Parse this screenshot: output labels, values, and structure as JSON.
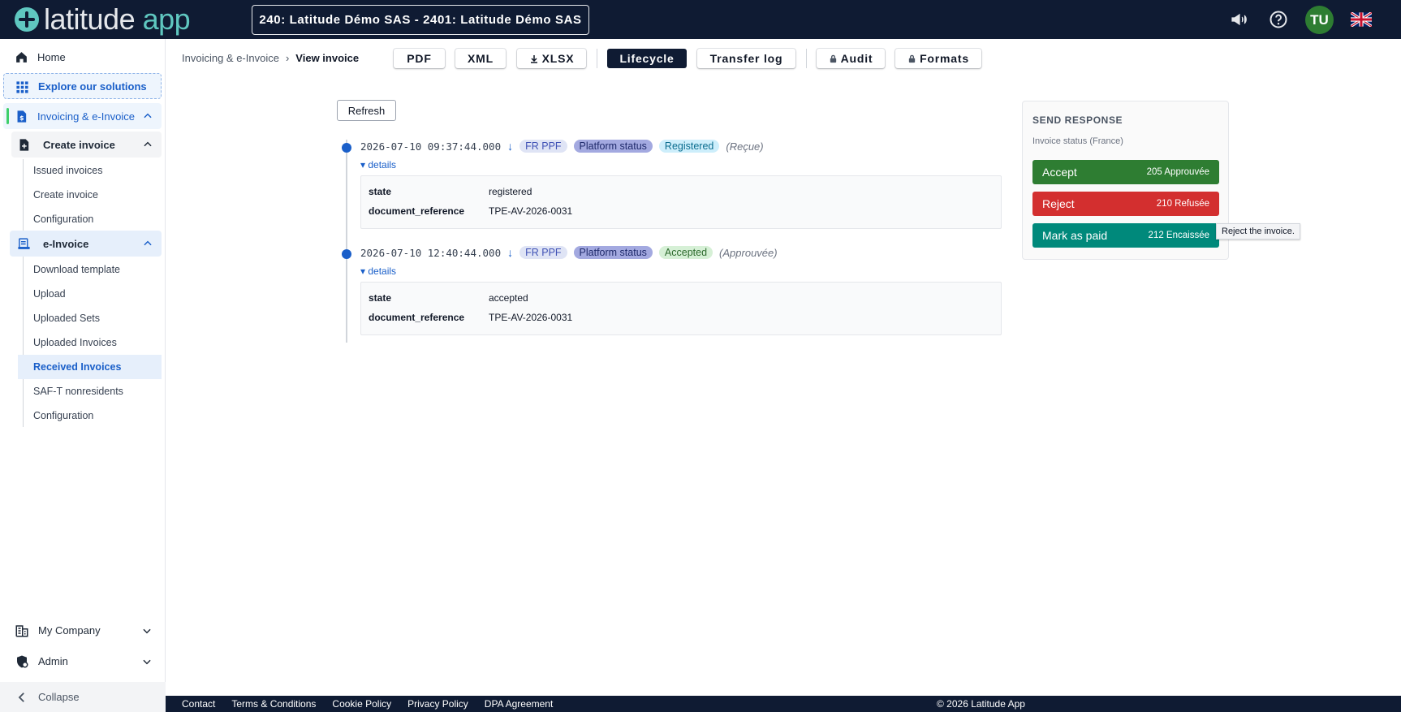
{
  "app": {
    "logo_word1": "latitude",
    "logo_word2": "app",
    "company": "240: Latitude Démo SAS - 2401: Latitude Démo SAS",
    "avatar": "TU"
  },
  "sidebar": {
    "home": "Home",
    "explore": "Explore our solutions",
    "invoicing": "Invoicing & e-Invoice",
    "create_group": "Create invoice",
    "create_items": [
      "Issued invoices",
      "Create invoice",
      "Configuration"
    ],
    "einvoice_group": "e-Invoice",
    "einvoice_items": [
      "Download template",
      "Upload",
      "Uploaded Sets",
      "Uploaded Invoices",
      "Received Invoices",
      "SAF-T nonresidents",
      "Configuration"
    ],
    "my_company": "My Company",
    "admin": "Admin",
    "collapse": "Collapse"
  },
  "breadcrumb": {
    "parent": "Invoicing & e-Invoice",
    "current": "View invoice"
  },
  "toolbar": {
    "pdf": "PDF",
    "xml": "XML",
    "xlsx": "XLSX",
    "lifecycle": "Lifecycle",
    "transfer_log": "Transfer log",
    "audit": "Audit",
    "formats": "Formats"
  },
  "refresh": "Refresh",
  "events": [
    {
      "timestamp": "2026-07-10 09:37:44.000",
      "arrow": "↓",
      "source": "FR PPF",
      "type": "Platform status",
      "status": "Registered",
      "note": "(Reçue)",
      "details": "details",
      "rows": [
        {
          "k": "state",
          "v": "registered"
        },
        {
          "k": "document_reference",
          "v": "TPE-AV-2026-0031"
        }
      ]
    },
    {
      "timestamp": "2026-07-10 12:40:44.000",
      "arrow": "↓",
      "source": "FR PPF",
      "type": "Platform status",
      "status": "Accepted",
      "note": "(Approuvée)",
      "details": "details",
      "rows": [
        {
          "k": "state",
          "v": "accepted"
        },
        {
          "k": "document_reference",
          "v": "TPE-AV-2026-0031"
        }
      ]
    }
  ],
  "response": {
    "title": "SEND RESPONSE",
    "subtitle": "Invoice status (France)",
    "accept": {
      "label": "Accept",
      "code": "205 Approuvée",
      "color": "#2e7d32"
    },
    "reject": {
      "label": "Reject",
      "code": "210 Refusée",
      "color": "#d32f2f"
    },
    "paid": {
      "label": "Mark as paid",
      "code": "212 Encaissée",
      "color": "#00897b"
    },
    "tooltip": "Reject the invoice."
  },
  "footer": {
    "contact": "Contact",
    "terms": "Terms & Conditions",
    "cookie": "Cookie Policy",
    "privacy": "Privacy Policy",
    "dpa": "DPA Agreement",
    "copyright": "© 2026 Latitude App"
  }
}
